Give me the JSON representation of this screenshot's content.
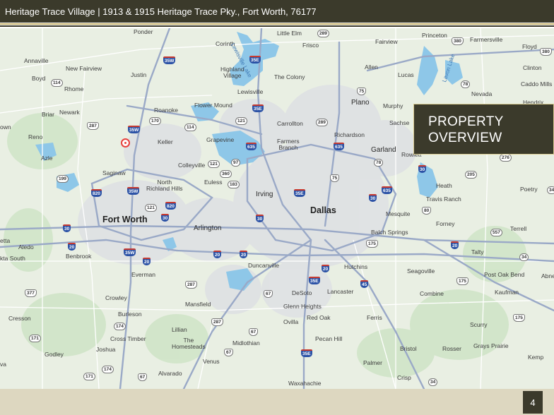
{
  "header": {
    "title": "Heritage Trace Village | 1913 & 1915 Heritage Trace Pky., Fort Worth, 76177"
  },
  "overview": {
    "line1": "PROPERTY",
    "line2": "OVERVIEW"
  },
  "footer": {
    "page_number": "4"
  },
  "colors": {
    "header_bg": "#3b3a2b",
    "gold_rule": "#c7b36f",
    "footer_bg": "#ddd7c0",
    "pin": "#e8413d",
    "water": "#8ec7e8",
    "land": "#e9efe3"
  },
  "map": {
    "labels": [
      {
        "id": "ponder",
        "text": "Ponder",
        "cls": ""
      },
      {
        "id": "little-elm",
        "text": "Little Elm",
        "cls": ""
      },
      {
        "id": "princeton",
        "text": "Princeton",
        "cls": ""
      },
      {
        "id": "farmersville",
        "text": "Farmersville",
        "cls": ""
      },
      {
        "id": "corinth",
        "text": "Corinth",
        "cls": ""
      },
      {
        "id": "frisco",
        "text": "Frisco",
        "cls": ""
      },
      {
        "id": "fairview",
        "text": "Fairview",
        "cls": ""
      },
      {
        "id": "floyd",
        "text": "Floyd",
        "cls": ""
      },
      {
        "id": "annaville",
        "text": "Annaville",
        "cls": ""
      },
      {
        "id": "new-fairview",
        "text": "New Fairview",
        "cls": ""
      },
      {
        "id": "highland-village",
        "text": "Highland\nVillage",
        "cls": ""
      },
      {
        "id": "allen",
        "text": "Allen",
        "cls": ""
      },
      {
        "id": "lucas",
        "text": "Lucas",
        "cls": ""
      },
      {
        "id": "clinton",
        "text": "Clinton",
        "cls": ""
      },
      {
        "id": "boyd",
        "text": "Boyd",
        "cls": ""
      },
      {
        "id": "justin",
        "text": "Justin",
        "cls": ""
      },
      {
        "id": "the-colony",
        "text": "The Colony",
        "cls": ""
      },
      {
        "id": "caddo-mills",
        "text": "Caddo Mills",
        "cls": ""
      },
      {
        "id": "rhome",
        "text": "Rhome",
        "cls": ""
      },
      {
        "id": "lewisville",
        "text": "Lewisville",
        "cls": ""
      },
      {
        "id": "nevada",
        "text": "Nevada",
        "cls": ""
      },
      {
        "id": "roanoke",
        "text": "Roanoke",
        "cls": ""
      },
      {
        "id": "flower-mound",
        "text": "Flower Mound",
        "cls": ""
      },
      {
        "id": "plano",
        "text": "Plano",
        "cls": "mid"
      },
      {
        "id": "murphy",
        "text": "Murphy",
        "cls": ""
      },
      {
        "id": "hendrix",
        "text": "Hendrix",
        "cls": ""
      },
      {
        "id": "briar",
        "text": "Briar",
        "cls": ""
      },
      {
        "id": "newark",
        "text": "Newark",
        "cls": ""
      },
      {
        "id": "carrollton",
        "text": "Carrollton",
        "cls": ""
      },
      {
        "id": "sachse",
        "text": "Sachse",
        "cls": ""
      },
      {
        "id": "town",
        "text": "own",
        "cls": ""
      },
      {
        "id": "richardson",
        "text": "Richardson",
        "cls": ""
      },
      {
        "id": "reno",
        "text": "Reno",
        "cls": ""
      },
      {
        "id": "keller",
        "text": "Keller",
        "cls": ""
      },
      {
        "id": "grapevine",
        "text": "Grapevine",
        "cls": ""
      },
      {
        "id": "farmers-branch",
        "text": "Farmers\nBranch",
        "cls": ""
      },
      {
        "id": "garland",
        "text": "Garland",
        "cls": "mid"
      },
      {
        "id": "rowlett",
        "text": "Rowlett",
        "cls": ""
      },
      {
        "id": "azle",
        "text": "Azle",
        "cls": ""
      },
      {
        "id": "colleyville",
        "text": "Colleyville",
        "cls": ""
      },
      {
        "id": "saginaw",
        "text": "Saginaw",
        "cls": ""
      },
      {
        "id": "heath",
        "text": "Heath",
        "cls": ""
      },
      {
        "id": "poetry",
        "text": "Poetry",
        "cls": ""
      },
      {
        "id": "north-richland-hills",
        "text": "North\nRichland Hills",
        "cls": ""
      },
      {
        "id": "euless",
        "text": "Euless",
        "cls": ""
      },
      {
        "id": "irving",
        "text": "Irving",
        "cls": "mid"
      },
      {
        "id": "travis-ranch",
        "text": "Travis Ranch",
        "cls": ""
      },
      {
        "id": "dallas",
        "text": "Dallas",
        "cls": "major"
      },
      {
        "id": "mesquite",
        "text": "Mesquite",
        "cls": ""
      },
      {
        "id": "fort-worth",
        "text": "Fort Worth",
        "cls": "major"
      },
      {
        "id": "forney",
        "text": "Forney",
        "cls": ""
      },
      {
        "id": "etta",
        "text": "etta",
        "cls": ""
      },
      {
        "id": "arlington",
        "text": "Arlington",
        "cls": "mid"
      },
      {
        "id": "terrell",
        "text": "Terrell",
        "cls": ""
      },
      {
        "id": "balch-springs",
        "text": "Balch Springs",
        "cls": ""
      },
      {
        "id": "aledo",
        "text": "Aledo",
        "cls": ""
      },
      {
        "id": "benbrook",
        "text": "Benbrook",
        "cls": ""
      },
      {
        "id": "talty",
        "text": "Talty",
        "cls": ""
      },
      {
        "id": "kta-south",
        "text": "kta South",
        "cls": ""
      },
      {
        "id": "duncanville",
        "text": "Duncanville",
        "cls": ""
      },
      {
        "id": "hutchins",
        "text": "Hutchins",
        "cls": ""
      },
      {
        "id": "everman",
        "text": "Everman",
        "cls": ""
      },
      {
        "id": "seagoville",
        "text": "Seagoville",
        "cls": ""
      },
      {
        "id": "post-oak-bend",
        "text": "Post Oak Bend",
        "cls": ""
      },
      {
        "id": "abner",
        "text": "Abne",
        "cls": ""
      },
      {
        "id": "desoto",
        "text": "DeSoto",
        "cls": ""
      },
      {
        "id": "lancaster",
        "text": "Lancaster",
        "cls": ""
      },
      {
        "id": "combine",
        "text": "Combine",
        "cls": ""
      },
      {
        "id": "crowley",
        "text": "Crowley",
        "cls": ""
      },
      {
        "id": "kaufman",
        "text": "Kaufman",
        "cls": ""
      },
      {
        "id": "mansfield",
        "text": "Mansfield",
        "cls": ""
      },
      {
        "id": "glenn-heights",
        "text": "Glenn Heights",
        "cls": ""
      },
      {
        "id": "burleson",
        "text": "Burleson",
        "cls": ""
      },
      {
        "id": "cresson",
        "text": "Cresson",
        "cls": ""
      },
      {
        "id": "ovilla",
        "text": "Ovilla",
        "cls": ""
      },
      {
        "id": "red-oak",
        "text": "Red Oak",
        "cls": ""
      },
      {
        "id": "ferris",
        "text": "Ferris",
        "cls": ""
      },
      {
        "id": "scurry",
        "text": "Scurry",
        "cls": ""
      },
      {
        "id": "lillian",
        "text": "Lillian",
        "cls": ""
      },
      {
        "id": "cross-timber",
        "text": "Cross Timber",
        "cls": ""
      },
      {
        "id": "the-homesteads",
        "text": "The\nHomesteads",
        "cls": ""
      },
      {
        "id": "midlothian",
        "text": "Midlothian",
        "cls": ""
      },
      {
        "id": "pecan-hill",
        "text": "Pecan Hill",
        "cls": ""
      },
      {
        "id": "grays-prairie",
        "text": "Grays Prairie",
        "cls": ""
      },
      {
        "id": "joshua",
        "text": "Joshua",
        "cls": ""
      },
      {
        "id": "bristol",
        "text": "Bristol",
        "cls": ""
      },
      {
        "id": "rosser",
        "text": "Rosser",
        "cls": ""
      },
      {
        "id": "godley",
        "text": "Godley",
        "cls": ""
      },
      {
        "id": "venus",
        "text": "Venus",
        "cls": ""
      },
      {
        "id": "palmer",
        "text": "Palmer",
        "cls": ""
      },
      {
        "id": "kemp",
        "text": "Kemp",
        "cls": ""
      },
      {
        "id": "va",
        "text": "va",
        "cls": ""
      },
      {
        "id": "alvarado",
        "text": "Alvarado",
        "cls": ""
      },
      {
        "id": "crisp",
        "text": "Crisp",
        "cls": ""
      },
      {
        "id": "waxahachie",
        "text": "Waxahachie",
        "cls": ""
      },
      {
        "id": "lewisville-lake",
        "text": "Lewisville Lake",
        "cls": "water"
      },
      {
        "id": "lavon-lake",
        "text": "Lavon Lake",
        "cls": "water"
      }
    ],
    "shields": [
      {
        "id": "s289a",
        "text": "289",
        "type": "st"
      },
      {
        "id": "s380a",
        "text": "380",
        "type": "us"
      },
      {
        "id": "s380b",
        "text": "380",
        "type": "us"
      },
      {
        "id": "s35w-a",
        "text": "35W",
        "type": "i"
      },
      {
        "id": "s35e-a",
        "text": "35E",
        "type": "i"
      },
      {
        "id": "s114a",
        "text": "114",
        "type": "st"
      },
      {
        "id": "s75a",
        "text": "75",
        "type": "us"
      },
      {
        "id": "s78a",
        "text": "78",
        "type": "st"
      },
      {
        "id": "s170",
        "text": "170",
        "type": "st"
      },
      {
        "id": "s35e-b",
        "text": "35E",
        "type": "i"
      },
      {
        "id": "s287a",
        "text": "287",
        "type": "us"
      },
      {
        "id": "s121a",
        "text": "121",
        "type": "st"
      },
      {
        "id": "s289b",
        "text": "289",
        "type": "st"
      },
      {
        "id": "s114b",
        "text": "114",
        "type": "st"
      },
      {
        "id": "s35w-b",
        "text": "35W",
        "type": "i"
      },
      {
        "id": "s635a",
        "text": "635",
        "type": "i"
      },
      {
        "id": "s635b",
        "text": "635",
        "type": "i"
      },
      {
        "id": "s121b",
        "text": "121",
        "type": "st"
      },
      {
        "id": "s97",
        "text": "97",
        "type": "st"
      },
      {
        "id": "s78b",
        "text": "78",
        "type": "st"
      },
      {
        "id": "s276",
        "text": "276",
        "type": "st"
      },
      {
        "id": "s199",
        "text": "199",
        "type": "st"
      },
      {
        "id": "s360",
        "text": "360",
        "type": "st"
      },
      {
        "id": "s30a",
        "text": "30",
        "type": "i"
      },
      {
        "id": "s205",
        "text": "205",
        "type": "st"
      },
      {
        "id": "s183",
        "text": "183",
        "type": "st"
      },
      {
        "id": "s75b",
        "text": "75",
        "type": "us"
      },
      {
        "id": "s820a",
        "text": "820",
        "type": "i"
      },
      {
        "id": "s35w-c",
        "text": "35W",
        "type": "i"
      },
      {
        "id": "s35e-c",
        "text": "35E",
        "type": "i"
      },
      {
        "id": "s30b",
        "text": "30",
        "type": "i"
      },
      {
        "id": "s635c",
        "text": "635",
        "type": "i"
      },
      {
        "id": "s34a",
        "text": "34",
        "type": "st"
      },
      {
        "id": "s121c",
        "text": "121",
        "type": "st"
      },
      {
        "id": "s820b",
        "text": "820",
        "type": "i"
      },
      {
        "id": "s80",
        "text": "80",
        "type": "us"
      },
      {
        "id": "s30c",
        "text": "30",
        "type": "i"
      },
      {
        "id": "s30d",
        "text": "30",
        "type": "i"
      },
      {
        "id": "s30e",
        "text": "30",
        "type": "i"
      },
      {
        "id": "s557",
        "text": "557",
        "type": "st"
      },
      {
        "id": "s175a",
        "text": "175",
        "type": "us"
      },
      {
        "id": "s20a",
        "text": "20",
        "type": "i"
      },
      {
        "id": "s20b",
        "text": "20",
        "type": "i"
      },
      {
        "id": "s35w-d",
        "text": "35W",
        "type": "i"
      },
      {
        "id": "s20c",
        "text": "20",
        "type": "i"
      },
      {
        "id": "s20d",
        "text": "20",
        "type": "i"
      },
      {
        "id": "s20e",
        "text": "20",
        "type": "i"
      },
      {
        "id": "s34b",
        "text": "34",
        "type": "st"
      },
      {
        "id": "s20f",
        "text": "20",
        "type": "i"
      },
      {
        "id": "s35e-d",
        "text": "35E",
        "type": "i"
      },
      {
        "id": "s45",
        "text": "45",
        "type": "i"
      },
      {
        "id": "s175b",
        "text": "175",
        "type": "us"
      },
      {
        "id": "s287b",
        "text": "287",
        "type": "us"
      },
      {
        "id": "s377",
        "text": "377",
        "type": "us"
      },
      {
        "id": "s67a",
        "text": "67",
        "type": "us"
      },
      {
        "id": "s174a",
        "text": "174",
        "type": "st"
      },
      {
        "id": "s175c",
        "text": "175",
        "type": "us"
      },
      {
        "id": "s171a",
        "text": "171",
        "type": "st"
      },
      {
        "id": "s287c",
        "text": "287",
        "type": "us"
      },
      {
        "id": "s67b",
        "text": "67",
        "type": "us"
      },
      {
        "id": "s67c",
        "text": "67",
        "type": "us"
      },
      {
        "id": "s35e-e",
        "text": "35E",
        "type": "i"
      },
      {
        "id": "s174b",
        "text": "174",
        "type": "st"
      },
      {
        "id": "s171b",
        "text": "171",
        "type": "st"
      },
      {
        "id": "s67d",
        "text": "67",
        "type": "us"
      },
      {
        "id": "s34c",
        "text": "34",
        "type": "st"
      }
    ]
  }
}
